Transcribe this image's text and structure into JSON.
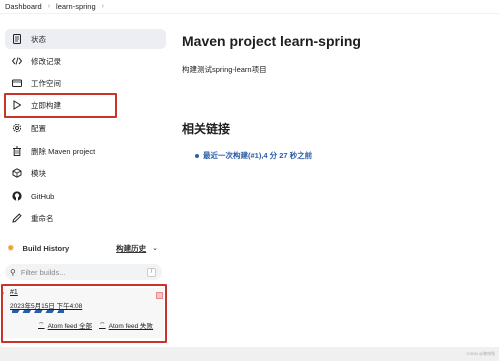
{
  "breadcrumb": {
    "items": [
      "Dashboard",
      "learn-spring"
    ]
  },
  "sidebar": {
    "items": [
      {
        "label": "状态",
        "icon": "document-icon"
      },
      {
        "label": "修改记录",
        "icon": "code-icon"
      },
      {
        "label": "工作空间",
        "icon": "folder-icon"
      },
      {
        "label": "立即构建",
        "icon": "play-icon"
      },
      {
        "label": "配置",
        "icon": "gear-icon"
      },
      {
        "label": "删除 Maven project",
        "icon": "trash-icon"
      },
      {
        "label": "模块",
        "icon": "cube-icon"
      },
      {
        "label": "GitHub",
        "icon": "github-icon"
      },
      {
        "label": "重命名",
        "icon": "pencil-icon"
      }
    ]
  },
  "build_history": {
    "title": "Build History",
    "trend_label": "构建历史",
    "filter_placeholder": "Filter builds...",
    "filter_shortcut": "/",
    "builds": [
      {
        "number": "#1",
        "date": "2023年5月15日 下午4:08"
      }
    ],
    "feeds": [
      "Atom feed 全部",
      "Atom feed 失败"
    ]
  },
  "main": {
    "title": "Maven project learn-spring",
    "description": "构建测试spring-learn项目",
    "section_title": "相关链接",
    "links": [
      "最近一次构建(#1),4 分 27 秒之前"
    ]
  },
  "footer": {
    "watermark": "CSDN @咖啡兔"
  },
  "colors": {
    "link": "#2b5ea8",
    "highlight_box": "#c8342a",
    "active_bg": "#eceef3"
  }
}
